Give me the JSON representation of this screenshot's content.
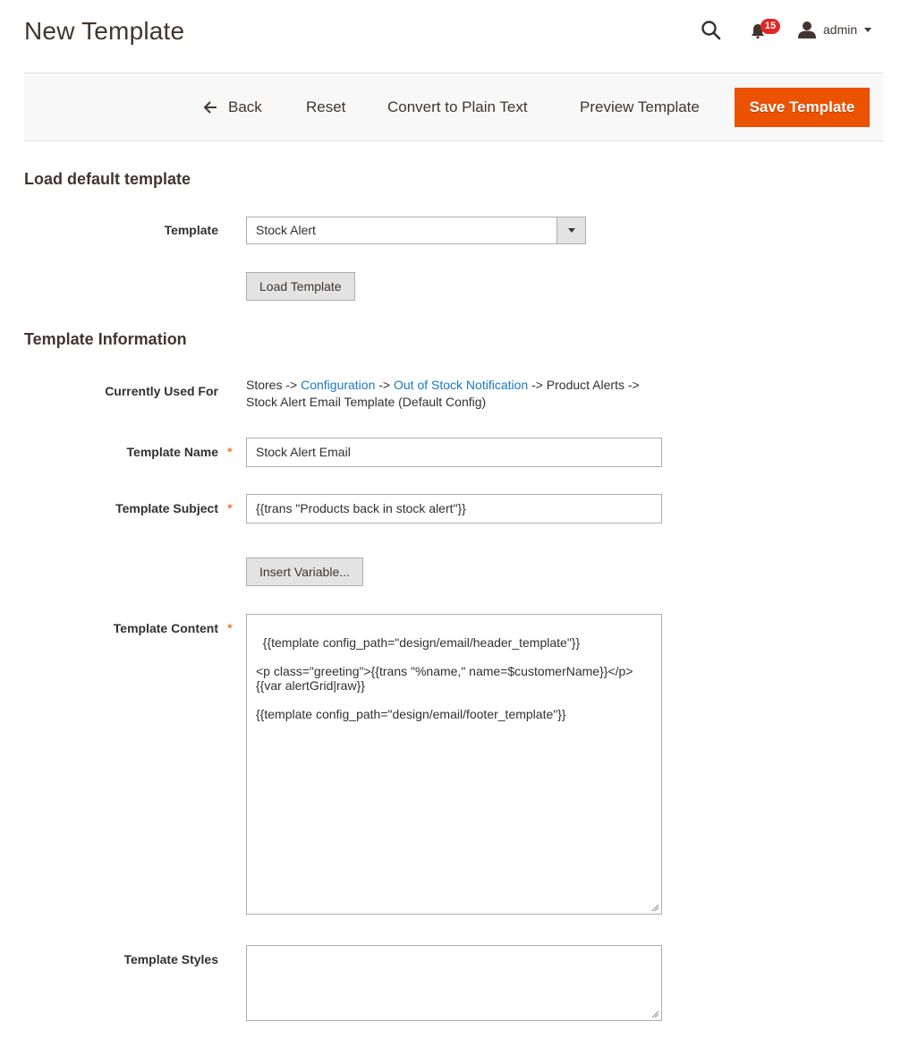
{
  "header": {
    "title": "New Template",
    "notifications_count": "15",
    "user_label": "admin",
    "icons": {
      "search": "search-icon",
      "notifications": "bell-icon",
      "user": "user-icon",
      "dropdown": "caret-down-icon"
    }
  },
  "actions": {
    "back_label": "Back",
    "reset_label": "Reset",
    "convert_label": "Convert to Plain Text",
    "preview_label": "Preview Template",
    "save_label": "Save Template"
  },
  "colors": {
    "accent": "#eb5202",
    "link": "#1979c3",
    "badge": "#e22626"
  },
  "load_default": {
    "section_title": "Load default template",
    "template_label": "Template",
    "template_selected": "Stock Alert",
    "load_button_label": "Load Template"
  },
  "template_info": {
    "section_title": "Template Information",
    "currently_used_for_label": "Currently Used For",
    "currently_used_for": {
      "part1": "Stores -> ",
      "link1": "Configuration",
      "part2": " -> ",
      "link2": "Out of Stock Notification",
      "part3": " -> Product Alerts -> Stock Alert Email Template  (Default Config)"
    },
    "name_label": "Template Name",
    "name_value": "Stock Alert Email",
    "subject_label": "Template Subject",
    "subject_value": "{{trans \"Products back in stock alert\"}}",
    "insert_variable_label": "Insert Variable...",
    "content_label": "Template Content",
    "content_value": "{{template config_path=\"design/email/header_template\"}}\n\n<p class=\"greeting\">{{trans \"%name,\" name=$customerName}}</p>\n{{var alertGrid|raw}}\n\n{{template config_path=\"design/email/footer_template\"}}",
    "styles_label": "Template Styles",
    "styles_value": "",
    "required_marker": "*"
  }
}
